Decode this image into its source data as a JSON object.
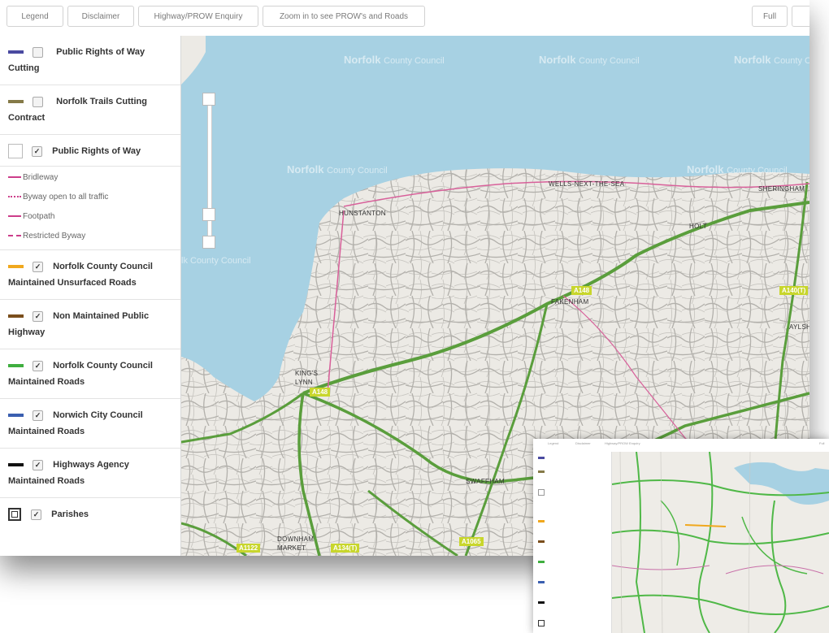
{
  "toolbar": {
    "legend": "Legend",
    "disclaimer": "Disclaimer",
    "enquiry": "Highway/PROW Enquiry",
    "zoom_hint": "Zoom in to see PROW's and Roads",
    "full": "Full"
  },
  "layers": {
    "prow_cutting": "Public Rights of Way Cutting",
    "trails_cutting": "Norfolk Trails Cutting Contract",
    "prow": "Public Rights of Way",
    "bridleway": "Bridleway",
    "byway": "Byway open to all traffic",
    "footpath": "Footpath",
    "restricted": "Restricted Byway",
    "ncc_unsurfaced": "Norfolk County Council Maintained Unsurfaced Roads",
    "non_maintained": "Non Maintained Public Highway",
    "ncc_roads": "Norfolk County Council Maintained Roads",
    "norwich": "Norwich City Council Maintained Roads",
    "highways_agency": "Highways Agency Maintained Roads",
    "parishes": "Parishes"
  },
  "colors": {
    "prow_cutting": "#4a4aa0",
    "trails_cutting": "#857a48",
    "prow_line": "#cc3d8a",
    "unsurfaced": "#f0a81e",
    "non_maintained": "#7a4e1c",
    "ncc_roads": "#3fae3f",
    "norwich": "#3b5fb0",
    "highways": "#111111",
    "sea": "#a7d1e3",
    "land": "#eceae5"
  },
  "map": {
    "towns": {
      "hunstanton": "HUNSTANTON",
      "wells": "WELLS-NEXT-THE-SEA",
      "sheringham": "SHERINGHAM",
      "holt": "HOLT",
      "fakenham": "FAKENHAM",
      "aylsham": "AYLSH",
      "kings_lynn": "KING'S LYNN",
      "swaffham": "SWAFFHAM",
      "downham": "DOWNHAM MARKET"
    },
    "roads": {
      "a148_fak": "A148",
      "a140": "A140(T)",
      "a148_kl": "A148",
      "a1065": "A1065",
      "a1122": "A1122",
      "a134": "A134(T)"
    },
    "watermark_brand": "Norfolk",
    "watermark_rest": "County Council",
    "watermark_partial": "lk County Council"
  },
  "thumbnail": {
    "legend": "Legend",
    "disclaimer": "Disclaimer",
    "enquiry": "Highway/PROW Enquiry",
    "full": "Full"
  }
}
